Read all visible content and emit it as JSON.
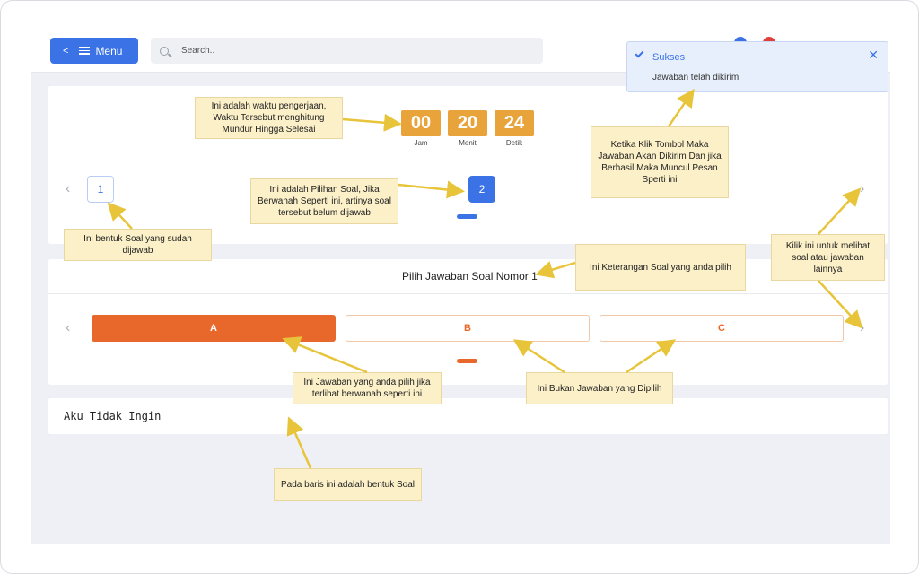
{
  "topbar": {
    "menu_label": "Menu",
    "search_placeholder": "Search.."
  },
  "timer": {
    "hours": "00",
    "hours_label": "Jam",
    "minutes": "20",
    "minutes_label": "Menit",
    "seconds": "24",
    "seconds_label": "Detik"
  },
  "questions": {
    "q1": "1",
    "q2": "2"
  },
  "answer_header": "Pilih Jawaban Soal Nomor 1",
  "options": {
    "a": "A",
    "b": "B",
    "c": "C"
  },
  "question_text": "Aku Tidak Ingin",
  "toast": {
    "title": "Sukses",
    "message": "Jawaban telah dikirim"
  },
  "notes": {
    "timer": "Ini adalah waktu pengerjaan, Waktu Tersebut menghitung Mundur Hingga Selesai",
    "unanswered": "Ini adalah Pilihan Soal, Jika Berwanah Seperti ini, artinya soal tersebut belum dijawab",
    "answered": "Ini bentuk Soal yang sudah dijawab",
    "submit": "Ketika Klik Tombol Maka Jawaban Akan Dikirim Dan jika Berhasil Maka Muncul Pesan Sperti ini",
    "header": "Ini Keterangan Soal yang anda pilih",
    "next": "Kilik ini untuk melihat soal atau jawaban lainnya",
    "chosen": "Ini Jawaban yang anda pilih jika terlihat berwanah seperti ini",
    "not_chosen": "Ini Bukan Jawaban yang Dipilih",
    "question_row": "Pada baris ini adalah bentuk Soal"
  },
  "colors": {
    "primary": "#3b73e6",
    "selected_option": "#e8682b",
    "timer": "#e9a33b",
    "note_bg": "#fcf0c8"
  }
}
